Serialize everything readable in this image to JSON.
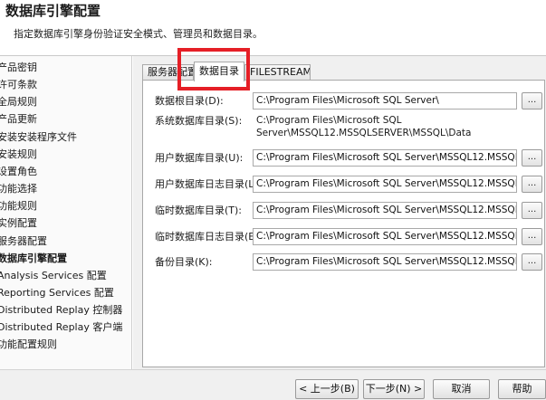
{
  "header": {
    "title": "数据库引擎配置",
    "subtitle": "指定数据库引擎身份验证安全模式、管理员和数据目录。"
  },
  "sidebar": {
    "items": [
      {
        "label": "产品密钥",
        "active": false
      },
      {
        "label": "许可条款",
        "active": false
      },
      {
        "label": "全局规则",
        "active": false
      },
      {
        "label": "产品更新",
        "active": false
      },
      {
        "label": "安装安装程序文件",
        "active": false
      },
      {
        "label": "安装规则",
        "active": false
      },
      {
        "label": "设置角色",
        "active": false
      },
      {
        "label": "功能选择",
        "active": false
      },
      {
        "label": "功能规则",
        "active": false
      },
      {
        "label": "实例配置",
        "active": false
      },
      {
        "label": "服务器配置",
        "active": false
      },
      {
        "label": "数据库引擎配置",
        "active": true
      },
      {
        "label": "Analysis Services 配置",
        "active": false
      },
      {
        "label": "Reporting Services 配置",
        "active": false
      },
      {
        "label": "Distributed Replay 控制器",
        "active": false
      },
      {
        "label": "Distributed Replay 客户端",
        "active": false
      },
      {
        "label": "功能配置规则",
        "active": false
      }
    ]
  },
  "tabs": [
    {
      "label": "服务器配置",
      "active": false
    },
    {
      "label": "数据目录",
      "active": true
    },
    {
      "label": "FILESTREAM",
      "active": false
    }
  ],
  "fields": {
    "data_root": {
      "label": "数据根目录(D):",
      "value": "C:\\Program Files\\Microsoft SQL Server\\"
    },
    "system_db": {
      "label": "系统数据库目录(S):",
      "value_line1": "C:\\Program Files\\Microsoft SQL",
      "value_line2": "Server\\MSSQL12.MSSQLSERVER\\MSSQL\\Data"
    },
    "user_db": {
      "label": "用户数据库目录(U):",
      "value": "C:\\Program Files\\Microsoft SQL Server\\MSSQL12.MSSQLSERVI"
    },
    "user_log": {
      "label": "用户数据库日志目录(L):",
      "value": "C:\\Program Files\\Microsoft SQL Server\\MSSQL12.MSSQLSERVI"
    },
    "temp_db": {
      "label": "临时数据库目录(T):",
      "value": "C:\\Program Files\\Microsoft SQL Server\\MSSQL12.MSSQLSERVI"
    },
    "temp_log": {
      "label": "临时数据库日志目录(E):",
      "value": "C:\\Program Files\\Microsoft SQL Server\\MSSQL12.MSSQLSERVI"
    },
    "backup": {
      "label": "备份目录(K):",
      "value": "C:\\Program Files\\Microsoft SQL Server\\MSSQL12.MSSQLSERVI"
    }
  },
  "browse_label": "...",
  "footer": {
    "back": "< 上一步(B)",
    "next": "下一步(N) >",
    "cancel": "取消",
    "help": "帮助"
  },
  "colors": {
    "highlight": "#e51f26"
  }
}
